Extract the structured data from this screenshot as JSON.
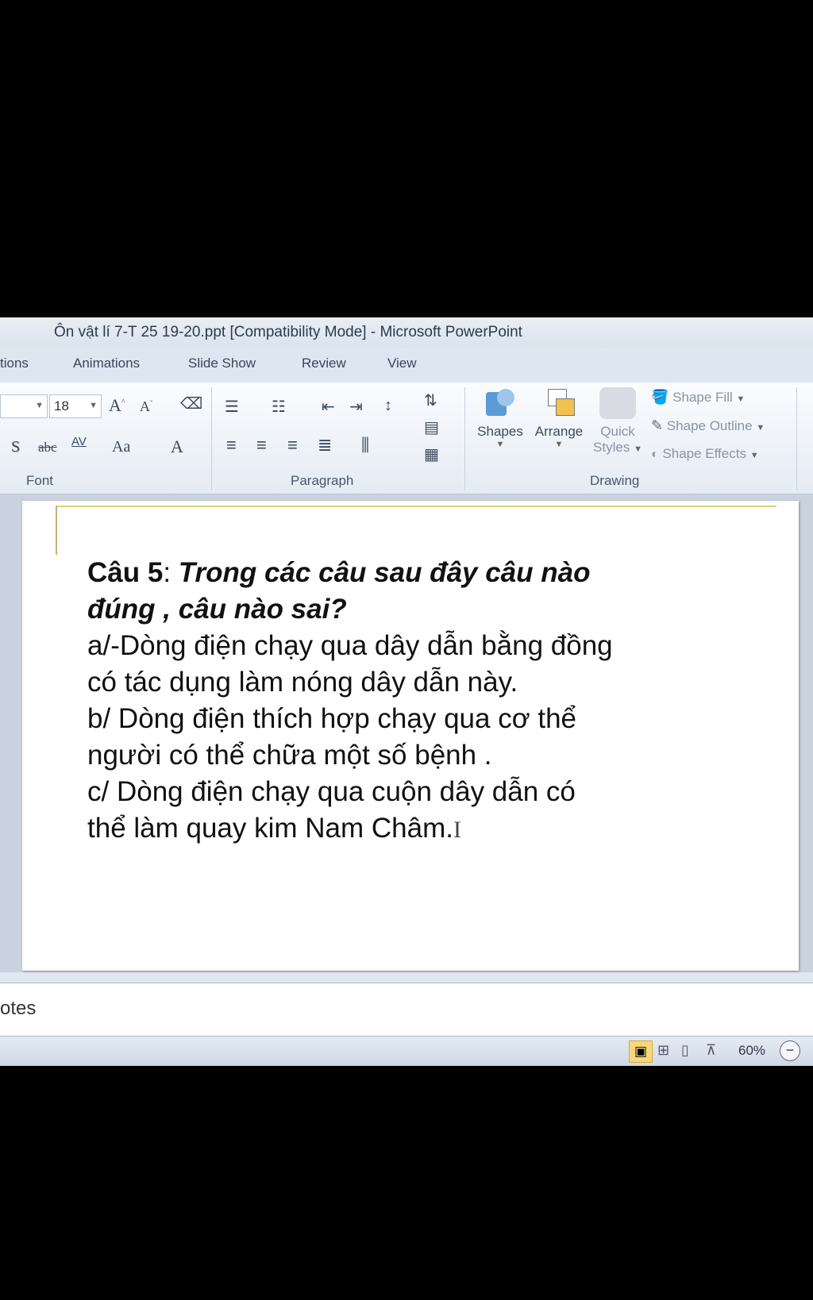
{
  "window": {
    "title": "Ôn vật lí 7-T 25 19-20.ppt [Compatibility Mode]  -  Microsoft PowerPoint"
  },
  "tabs": [
    "tions",
    "Animations",
    "Slide Show",
    "Review",
    "View"
  ],
  "ribbon": {
    "font": {
      "size": "18",
      "group_label": "Font",
      "grow": "A",
      "shrink": "A",
      "shadow": "S",
      "strike": "abc",
      "spacing": "AV",
      "case": "Aa",
      "color": "A"
    },
    "paragraph": {
      "group_label": "Paragraph"
    },
    "drawing": {
      "group_label": "Drawing",
      "shapes": "Shapes",
      "arrange": "Arrange",
      "quick": "Quick",
      "styles": "Styles",
      "shape_fill": "Shape Fill",
      "shape_outline": "Shape Outline",
      "shape_effects": "Shape Effects"
    }
  },
  "slide": {
    "q_label": "Câu 5",
    "q_colon": ": ",
    "q_italic_1": "Trong các câu sau đây câu nào",
    "q_italic_2": "đúng , câu nào sai?",
    "lines": [
      "a/-Dòng điện chạy qua dây dẫn bằng đồng",
      "có tác dụng làm nóng dây dẫn này.",
      "b/ Dòng điện thích hợp chạy qua cơ thể",
      "người có thể chữa một số bệnh .",
      "c/ Dòng điện chạy qua cuộn dây dẫn có",
      "thể làm quay kim Nam Châm."
    ]
  },
  "notes": {
    "label": "otes"
  },
  "status": {
    "zoom": "60%"
  }
}
